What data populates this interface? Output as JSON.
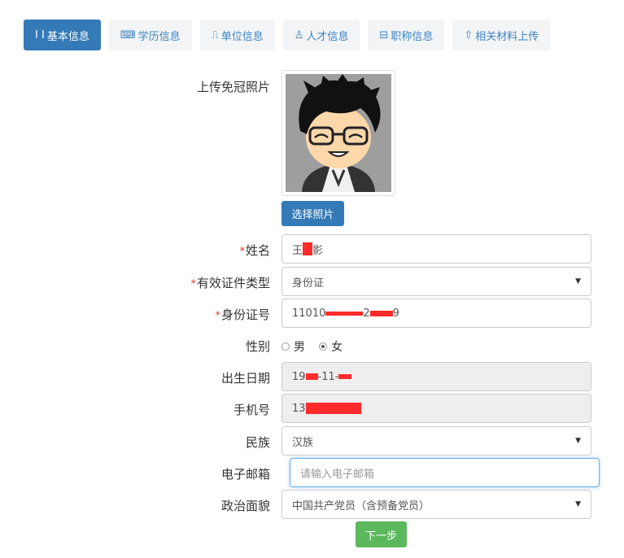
{
  "tabs": [
    {
      "icon": "id-card-icon",
      "glyph": "I I",
      "label": "基本信息",
      "active": true
    },
    {
      "icon": "graduation-icon",
      "glyph": "⌨",
      "label": "学历信息",
      "active": false
    },
    {
      "icon": "building-icon",
      "glyph": "⎍",
      "label": "单位信息",
      "active": false
    },
    {
      "icon": "user-icon",
      "glyph": "♙",
      "label": "人才信息",
      "active": false
    },
    {
      "icon": "certificate-icon",
      "glyph": "⊟",
      "label": "职称信息",
      "active": false
    },
    {
      "icon": "upload-icon",
      "glyph": "⇧",
      "label": "相关材料上传",
      "active": false
    }
  ],
  "photo": {
    "label": "上传免冠照片",
    "button": "选择照片"
  },
  "name": {
    "required": "*",
    "label": "姓名",
    "value_start": "王",
    "value_end": "影"
  },
  "id_type": {
    "required": "*",
    "label": "有效证件类型",
    "value": "身份证"
  },
  "id_number": {
    "required": "*",
    "label": "身份证号",
    "value_start": "11010",
    "value_mid": "2",
    "value_end": "9"
  },
  "gender": {
    "label": "性别",
    "options": [
      "男",
      "女"
    ],
    "selected": "女"
  },
  "birth": {
    "label": "出生日期",
    "value_start": "19",
    "value_mid": "-11-"
  },
  "phone": {
    "label": "手机号",
    "value_start": "13"
  },
  "ethnicity": {
    "label": "民族",
    "value": "汉族"
  },
  "email": {
    "label": "电子邮箱",
    "placeholder": "请输入电子邮箱"
  },
  "political": {
    "label": "政治面貌",
    "value": "中国共产党员（含预备党员）"
  },
  "next_button": "下一步",
  "colors": {
    "primary": "#337ab7",
    "success": "#5cb85c",
    "required": "#e53935",
    "redaction": "#ff2a2a"
  }
}
